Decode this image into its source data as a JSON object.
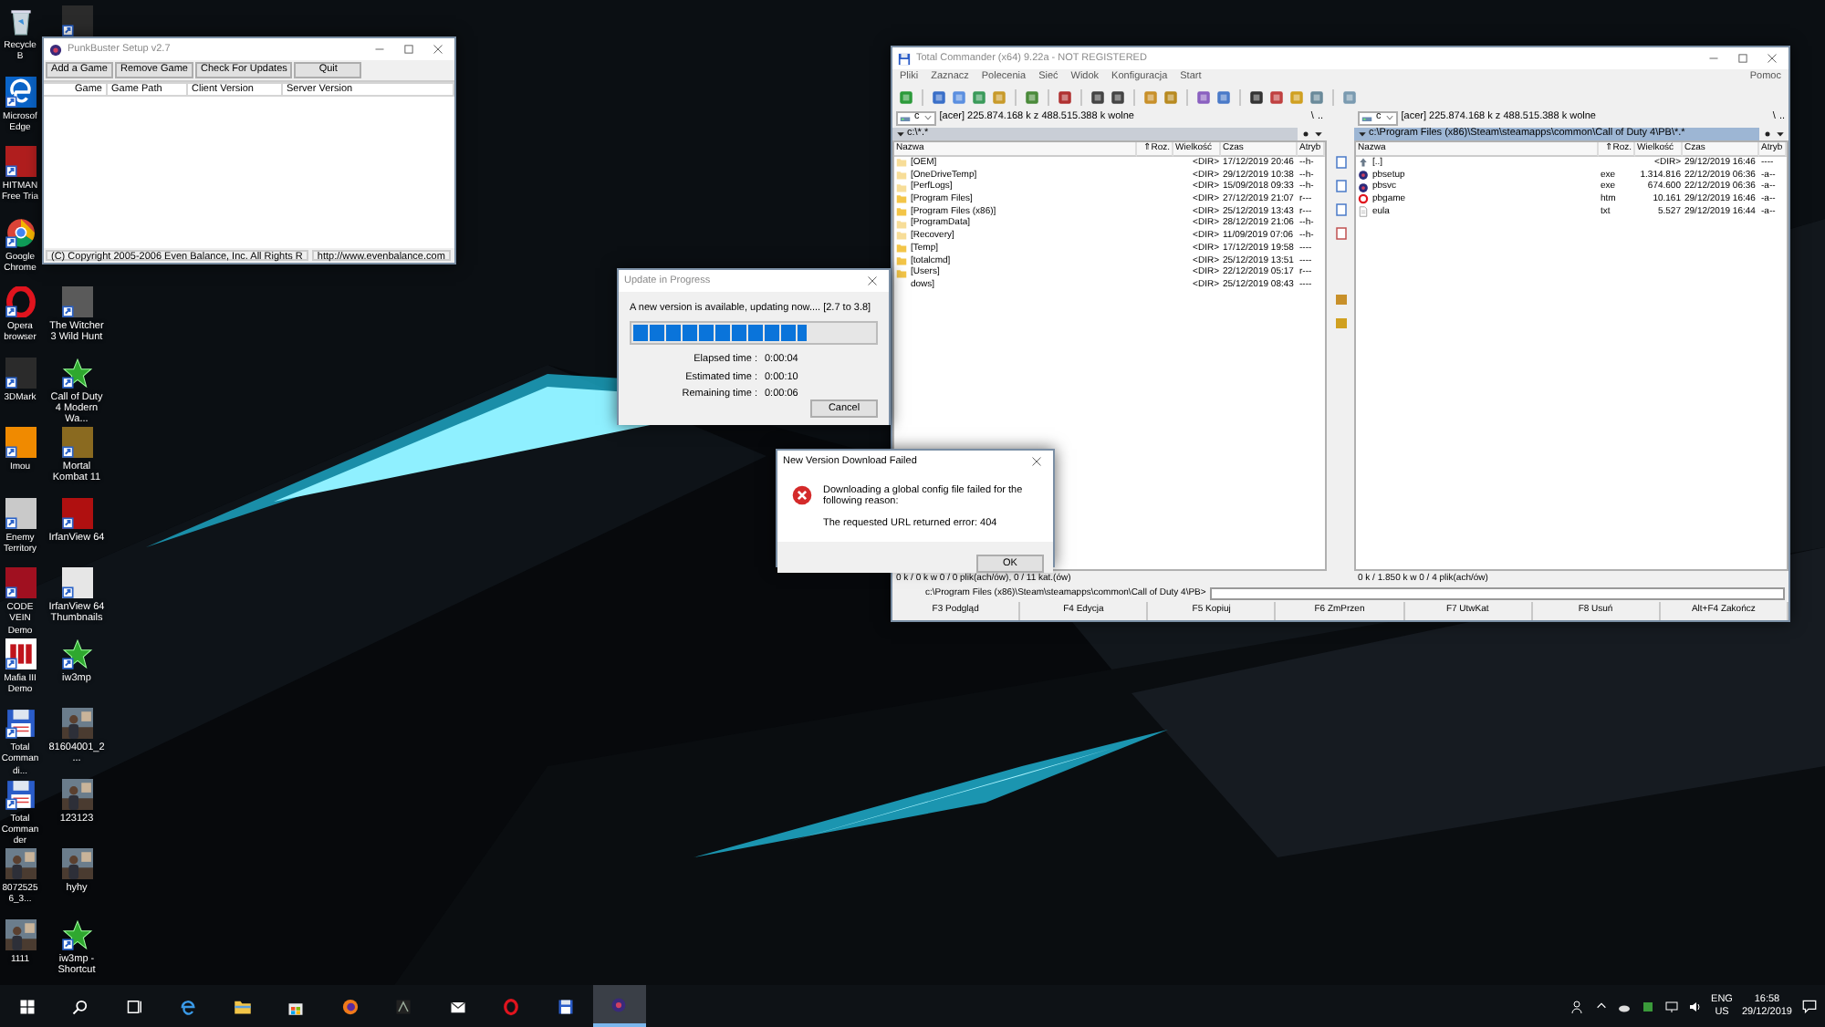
{
  "desktop": {
    "column_1": [
      {
        "label": "Recycle B",
        "kind": "bin"
      },
      {
        "label": "Microsof Edge",
        "kind": "edge"
      },
      {
        "label": "HITMAN Free Tria",
        "kind": "tile",
        "color": "#b01e1e"
      },
      {
        "label": "Google Chrome",
        "kind": "chrome"
      },
      {
        "label": "Opera browser",
        "kind": "opera"
      },
      {
        "label": "3DMark",
        "kind": "tile",
        "color": "#2b2b2b"
      },
      {
        "label": "Imou",
        "kind": "tile",
        "color": "#f08a00"
      },
      {
        "label": "Enemy Territory",
        "kind": "tile",
        "color": "#c9c9c9"
      },
      {
        "label": "CODE VEIN Demo",
        "kind": "tile",
        "color": "#a01020"
      },
      {
        "label": "Mafia III Demo",
        "kind": "bars"
      },
      {
        "label": "Total Commandi...",
        "kind": "floppy"
      },
      {
        "label": "Total Commander",
        "kind": "floppy"
      },
      {
        "label": "80725256_3..."
      },
      {
        "label": "1111"
      }
    ],
    "column_2_top": [
      {
        "kind": "tile",
        "color": "#2b2b2b"
      }
    ],
    "column_2": [
      {
        "label": "The Witcher 3 Wild Hunt",
        "kind": "tile",
        "color": "#5a5a5a"
      },
      {
        "label": "Call of Duty 4 Modern Wa...",
        "kind": "star"
      },
      {
        "label": "Mortal Kombat 11",
        "kind": "tile",
        "color": "#8a6a20"
      },
      {
        "label": "IrfanView 64",
        "kind": "tile",
        "color": "#b01010"
      },
      {
        "label": "IrfanView 64 Thumbnails",
        "kind": "tile",
        "color": "#e6e6e6"
      },
      {
        "label": "iw3mp",
        "kind": "star"
      },
      {
        "label": "81604001_2..."
      },
      {
        "label": "123123"
      },
      {
        "label": "hyhy"
      },
      {
        "label": "iw3mp - Shortcut",
        "kind": "star"
      }
    ]
  },
  "punkbuster": {
    "title": "PunkBuster Setup v2.7",
    "buttons": [
      "Add a Game",
      "Remove Game",
      "Check For Updates",
      "Quit"
    ],
    "columns": [
      "Game",
      "Game Path",
      "Client Version",
      "Server Version"
    ],
    "status": [
      "(C) Copyright 2005-2006 Even Balance, Inc.  All Rights R",
      "http://www.evenbalance.com"
    ]
  },
  "total_commander": {
    "title": "Total Commander (x64) 9.22a - NOT REGISTERED",
    "menu": [
      "Pliki",
      "Zaznacz",
      "Polecenia",
      "Sieć",
      "Widok",
      "Konfiguracja",
      "Start"
    ],
    "help_menu": "Pomoc",
    "panels": [
      {
        "active": false,
        "drive": "c",
        "free_space": "[acer]  225.874.168 k z 488.515.388 k wolne",
        "root_button": "\\",
        "up_button": "..",
        "path": "c:\\*.*",
        "columns": [
          "Nazwa",
          "⇑Roz.",
          "Wielkość",
          "Czas",
          "Atryb"
        ],
        "rows": [
          {
            "kind": "hidden_folder",
            "name": "[OEM]",
            "size": "<DIR>",
            "date": "17/12/2019 20:46",
            "attr": "--h-"
          },
          {
            "kind": "hidden_folder",
            "name": "[OneDriveTemp]",
            "size": "<DIR>",
            "date": "29/12/2019 10:38",
            "attr": "--h-"
          },
          {
            "kind": "hidden_folder",
            "name": "[PerfLogs]",
            "size": "<DIR>",
            "date": "15/09/2018 09:33",
            "attr": "--h-"
          },
          {
            "kind": "folder",
            "name": "[Program Files]",
            "size": "<DIR>",
            "date": "27/12/2019 21:07",
            "attr": "r---"
          },
          {
            "kind": "folder",
            "name": "[Program Files (x86)]",
            "size": "<DIR>",
            "date": "25/12/2019 13:43",
            "attr": "r---"
          },
          {
            "kind": "hidden_folder",
            "name": "[ProgramData]",
            "size": "<DIR>",
            "date": "28/12/2019 21:06",
            "attr": "--h-"
          },
          {
            "kind": "hidden_folder",
            "name": "[Recovery]",
            "size": "<DIR>",
            "date": "11/09/2019 07:06",
            "attr": "--h-"
          },
          {
            "kind": "folder",
            "name": "[Temp]",
            "size": "<DIR>",
            "date": "17/12/2019 19:58",
            "attr": "----"
          },
          {
            "kind": "folder",
            "name": "[totalcmd]",
            "size": "<DIR>",
            "date": "25/12/2019 13:51",
            "attr": "----"
          },
          {
            "kind": "folder",
            "name": "[Users]",
            "size": "<DIR>",
            "date": "22/12/2019 05:17",
            "attr": "r---"
          },
          {
            "name": "dows]",
            "size": "<DIR>",
            "date": "25/12/2019 08:43",
            "attr": "----"
          }
        ],
        "status": "0 k / 0 k w 0 / 0 plik(ach/ów), 0 / 11 kat.(ów)"
      },
      {
        "active": true,
        "drive": "c",
        "free_space": "[acer]  225.874.168 k z 488.515.388 k wolne",
        "root_button": "\\",
        "up_button": "..",
        "path": "c:\\Program Files (x86)\\Steam\\steamapps\\common\\Call of Duty 4\\PB\\*.*",
        "columns": [
          "Nazwa",
          "⇑Roz.",
          "Wielkość",
          "Czas",
          "Atryb"
        ],
        "rows": [
          {
            "kind": "up",
            "name": "[..]",
            "size": "<DIR>",
            "date": "29/12/2019 16:46",
            "attr": "----"
          },
          {
            "kind": "exe",
            "name": "pbsetup",
            "ext": "exe",
            "size": "1.314.816",
            "date": "22/12/2019 06:36",
            "attr": "-a--"
          },
          {
            "kind": "exe",
            "name": "pbsvc",
            "ext": "exe",
            "size": "674.600",
            "date": "22/12/2019 06:36",
            "attr": "-a--"
          },
          {
            "kind": "html",
            "name": "pbgame",
            "ext": "htm",
            "size": "10.161",
            "date": "29/12/2019 16:46",
            "attr": "-a--"
          },
          {
            "kind": "text",
            "name": "eula",
            "ext": "txt",
            "size": "5.527",
            "date": "29/12/2019 16:44",
            "attr": "-a--"
          }
        ],
        "status": "0 k / 1.850 k w 0 / 4 plik(ach/ów)"
      }
    ],
    "command_prompt": "c:\\Program Files (x86)\\Steam\\steamapps\\common\\Call of Duty 4\\PB>",
    "function_keys": [
      "F3 Podgląd",
      "F4 Edycja",
      "F5 Kopiuj",
      "F6 ZmPrzen",
      "F7 UtwKat",
      "F8 Usuń",
      "Alt+F4 Zakończ"
    ]
  },
  "update_dialog": {
    "title": "Update in Progress",
    "message": "A new version is available, updating now.... [2.7 to 3.8]",
    "level": 0.72,
    "times": [
      {
        "label": "Elapsed time :",
        "value": "0:00:04"
      },
      {
        "label": "Estimated time :",
        "value": "0:00:10"
      },
      {
        "label": "Remaining time :",
        "value": "0:00:06"
      }
    ],
    "cancel": "Cancel"
  },
  "error_dialog": {
    "title": "New Version Download Failed",
    "message": "Downloading a global config file failed for the following reason:",
    "detail": "The requested URL returned error: 404",
    "ok": "OK"
  },
  "taskbar": {
    "apps": [
      {
        "kind": "start",
        "selected": false
      },
      {
        "kind": "search",
        "selected": false
      },
      {
        "kind": "taskview",
        "selected": false
      },
      {
        "kind": "edge",
        "selected": false
      },
      {
        "kind": "folder",
        "selected": false
      },
      {
        "kind": "store",
        "selected": false
      },
      {
        "kind": "firefox",
        "selected": false
      },
      {
        "kind": "game",
        "selected": false
      },
      {
        "kind": "mail",
        "selected": false
      },
      {
        "kind": "opera",
        "selected": false
      },
      {
        "kind": "floppy",
        "selected": false
      },
      {
        "kind": "punkbuster",
        "selected": true
      }
    ],
    "language": "ENG",
    "region": "US",
    "time": "16:58",
    "date": "29/12/2019"
  }
}
